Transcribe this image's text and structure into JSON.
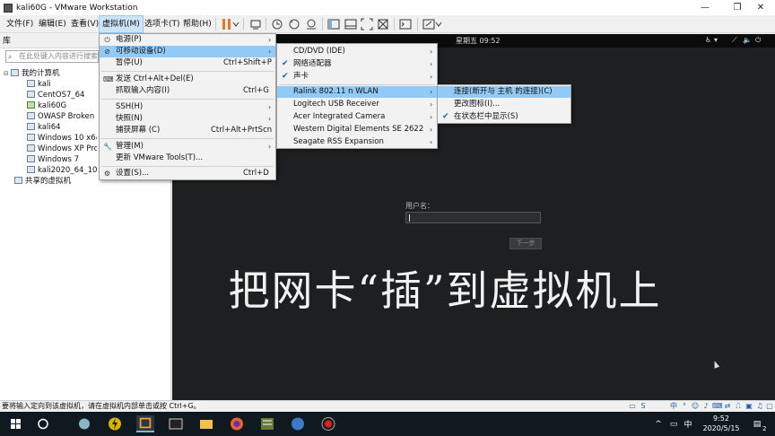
{
  "window": {
    "title": "kali60G - VMware Workstation",
    "min": "—",
    "restore": "❐",
    "close": "✕"
  },
  "menubar": {
    "items": [
      "文件(F)",
      "编辑(E)",
      "查看(V)",
      "虚拟机(M)",
      "选项卡(T)",
      "帮助(H)"
    ]
  },
  "library": {
    "title": "库",
    "close": "×",
    "search_placeholder": "在此处键入内容进行搜索",
    "root": "我的计算机",
    "vms": [
      "kali",
      "CentOS7_64",
      "kali60G",
      "OWASP Broken W",
      "kali64",
      "Windows 10 x64",
      "Windows XP Profe",
      "Windows 7",
      "kali2020_64_1000"
    ],
    "shared": "共享的虚拟机"
  },
  "vm_menu": {
    "items": [
      {
        "label": "电源(P)",
        "shortcut": "",
        "submenu": true,
        "icon": "power-icon"
      },
      {
        "label": "可移动设备(D)",
        "shortcut": "",
        "submenu": true,
        "icon": "removable-devices-icon"
      },
      {
        "label": "暂停(U)",
        "shortcut": "Ctrl+Shift+P",
        "submenu": false,
        "icon": ""
      },
      {
        "label": "发送 Ctrl+Alt+Del(E)",
        "shortcut": "",
        "submenu": false,
        "icon": "keyboard-icon"
      },
      {
        "label": "抓取输入内容(I)",
        "shortcut": "Ctrl+G",
        "submenu": false,
        "icon": ""
      },
      {
        "label": "SSH(H)",
        "shortcut": "",
        "submenu": true,
        "icon": ""
      },
      {
        "label": "快照(N)",
        "shortcut": "",
        "submenu": true,
        "icon": ""
      },
      {
        "label": "捕获屏幕 (C)",
        "shortcut": "Ctrl+Alt+PrtScn",
        "submenu": false,
        "icon": ""
      },
      {
        "label": "管理(M)",
        "shortcut": "",
        "submenu": true,
        "icon": "wrench-icon"
      },
      {
        "label": "更新 VMware Tools(T)...",
        "shortcut": "",
        "submenu": false,
        "icon": ""
      },
      {
        "label": "设置(S)...",
        "shortcut": "Ctrl+D",
        "submenu": false,
        "icon": "settings-icon"
      }
    ]
  },
  "devices_menu": {
    "items": [
      {
        "label": "CD/DVD (IDE)",
        "checked": false
      },
      {
        "label": "网络适配器",
        "checked": true
      },
      {
        "label": "声卡",
        "checked": true
      },
      {
        "label": "Ralink 802.11 n WLAN",
        "checked": false
      },
      {
        "label": "Logitech USB Receiver",
        "checked": false
      },
      {
        "label": "Acer Integrated Camera",
        "checked": false
      },
      {
        "label": "Western Digital Elements SE 2622",
        "checked": false
      },
      {
        "label": "Seagate RSS Expansion",
        "checked": false
      }
    ]
  },
  "wlan_menu": {
    "items": [
      {
        "label": "连接(断开与 主机 的连接)(C)",
        "checked": false
      },
      {
        "label": "更改图标(I)...",
        "checked": false
      },
      {
        "label": "在状态栏中显示(S)",
        "checked": true
      }
    ]
  },
  "vm_screen": {
    "clock": "星期五 09:52",
    "username_label": "用户名：",
    "next_button": "下一步",
    "caption": "把网卡“插”到虚拟机上"
  },
  "statusbar": {
    "message": "要将输入定向到该虚拟机，请在虚拟机内部单击或按 Ctrl+G。",
    "ime": "中"
  },
  "taskbar": {
    "time": "9:52",
    "date": "2020/5/15",
    "ime": "中",
    "notifications": "2"
  },
  "colors": {
    "menu_highlight": "#91c9f7",
    "vm_background": "#1e1f20",
    "taskbar": "#101820"
  }
}
